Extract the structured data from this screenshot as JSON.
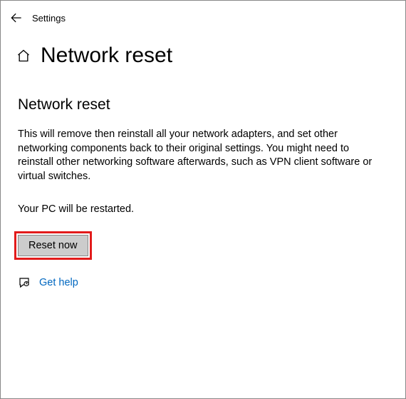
{
  "header": {
    "app_title": "Settings"
  },
  "page": {
    "title": "Network reset",
    "sub_title": "Network reset",
    "description": "This will remove then reinstall all your network adapters, and set other networking components back to their original settings. You might need to reinstall other networking software afterwards, such as VPN client software or virtual switches.",
    "restart_note": "Your PC will be restarted.",
    "reset_button": "Reset now",
    "help_link": "Get help"
  }
}
